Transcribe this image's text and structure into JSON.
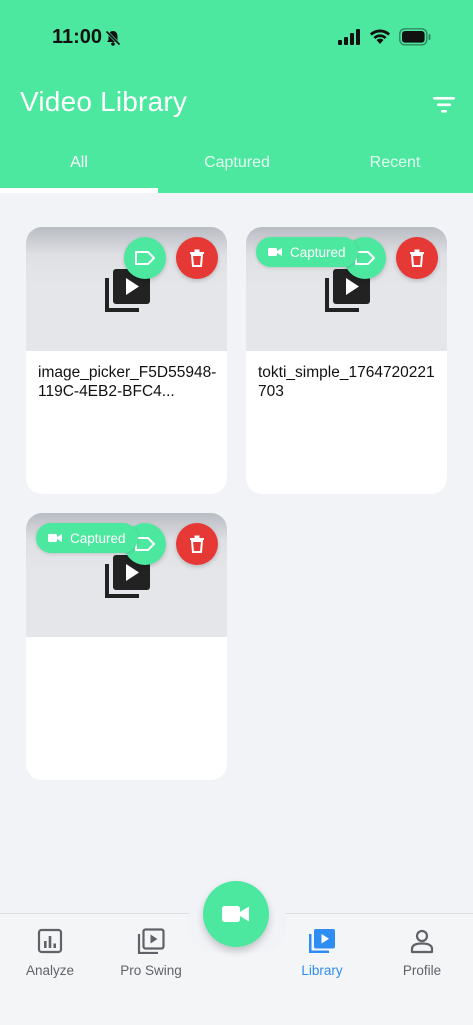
{
  "status": {
    "time": "11:00"
  },
  "header": {
    "title": "Video Library",
    "tabs": [
      {
        "label": "All",
        "active": true
      },
      {
        "label": "Captured",
        "active": false
      },
      {
        "label": "Recent",
        "active": false
      }
    ]
  },
  "videos": [
    {
      "name": "image_picker_F5D55948-119C-4EB2-BFC4...",
      "captured": false
    },
    {
      "name": "tokti_simple_1764720221703",
      "captured": true,
      "badge": "Captured"
    },
    {
      "name": "",
      "captured": true,
      "badge": "Captured"
    }
  ],
  "nav": {
    "items": [
      {
        "label": "Analyze",
        "icon": "chart-icon",
        "active": false
      },
      {
        "label": "Pro Swing",
        "icon": "video-library-icon",
        "active": false
      },
      {
        "label": "Library",
        "icon": "video-library-icon",
        "active": true
      },
      {
        "label": "Profile",
        "icon": "person-icon",
        "active": false
      }
    ],
    "fab_icon": "video-camera-icon"
  },
  "colors": {
    "accent": "#4de8a0",
    "delete": "#e63935",
    "active_nav": "#2f8cf3"
  }
}
